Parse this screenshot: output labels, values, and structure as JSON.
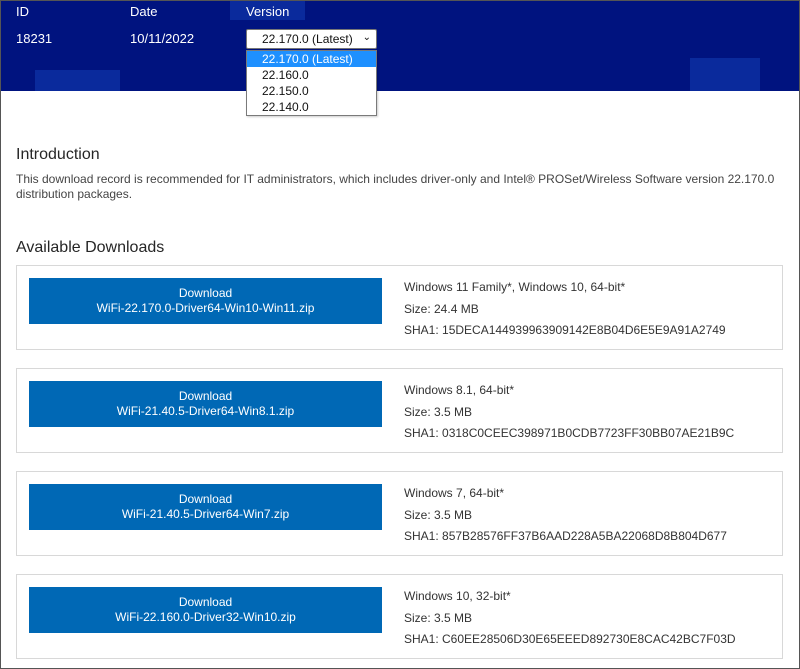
{
  "header": {
    "columns": {
      "id": "ID",
      "date": "Date",
      "version": "Version"
    },
    "id_value": "18231",
    "date_value": "10/11/2022",
    "version_select": {
      "selected": "22.170.0 (Latest)",
      "options": [
        "22.170.0 (Latest)",
        "22.160.0",
        "22.150.0",
        "22.140.0"
      ],
      "chevron_icon": "chevron-down-icon"
    }
  },
  "intro": {
    "heading": "Introduction",
    "text": "This download record is recommended for IT administrators, which includes driver-only and Intel® PROSet/Wireless Software version 22.170.0 distribution packages."
  },
  "downloads": {
    "heading": "Available Downloads",
    "items": [
      {
        "button_label": "Download",
        "filename": "WiFi-22.170.0-Driver64-Win10-Win11.zip",
        "os": "Windows 11 Family*, Windows 10, 64-bit*",
        "size": "Size: 24.4 MB",
        "sha1": "SHA1: 15DECA144939963909142E8B04D6E5E9A91A2749"
      },
      {
        "button_label": "Download",
        "filename": "WiFi-21.40.5-Driver64-Win8.1.zip",
        "os": "Windows 8.1, 64-bit*",
        "size": "Size: 3.5 MB",
        "sha1": "SHA1: 0318C0CEEC398971B0CDB7723FF30BB07AE21B9C"
      },
      {
        "button_label": "Download",
        "filename": "WiFi-21.40.5-Driver64-Win7.zip",
        "os": "Windows 7, 64-bit*",
        "size": "Size: 3.5 MB",
        "sha1": "SHA1: 857B28576FF37B6AAD228A5BA22068D8B804D677"
      },
      {
        "button_label": "Download",
        "filename": "WiFi-22.160.0-Driver32-Win10.zip",
        "os": "Windows 10, 32-bit*",
        "size": "Size: 3.5 MB",
        "sha1": "SHA1: C60EE28506D30E65EEED892730E8CAC42BC7F03D"
      }
    ]
  },
  "colors": {
    "header_bg": "#00137f",
    "button_bg": "#0068b5",
    "dropdown_highlight": "#1e90ff"
  }
}
